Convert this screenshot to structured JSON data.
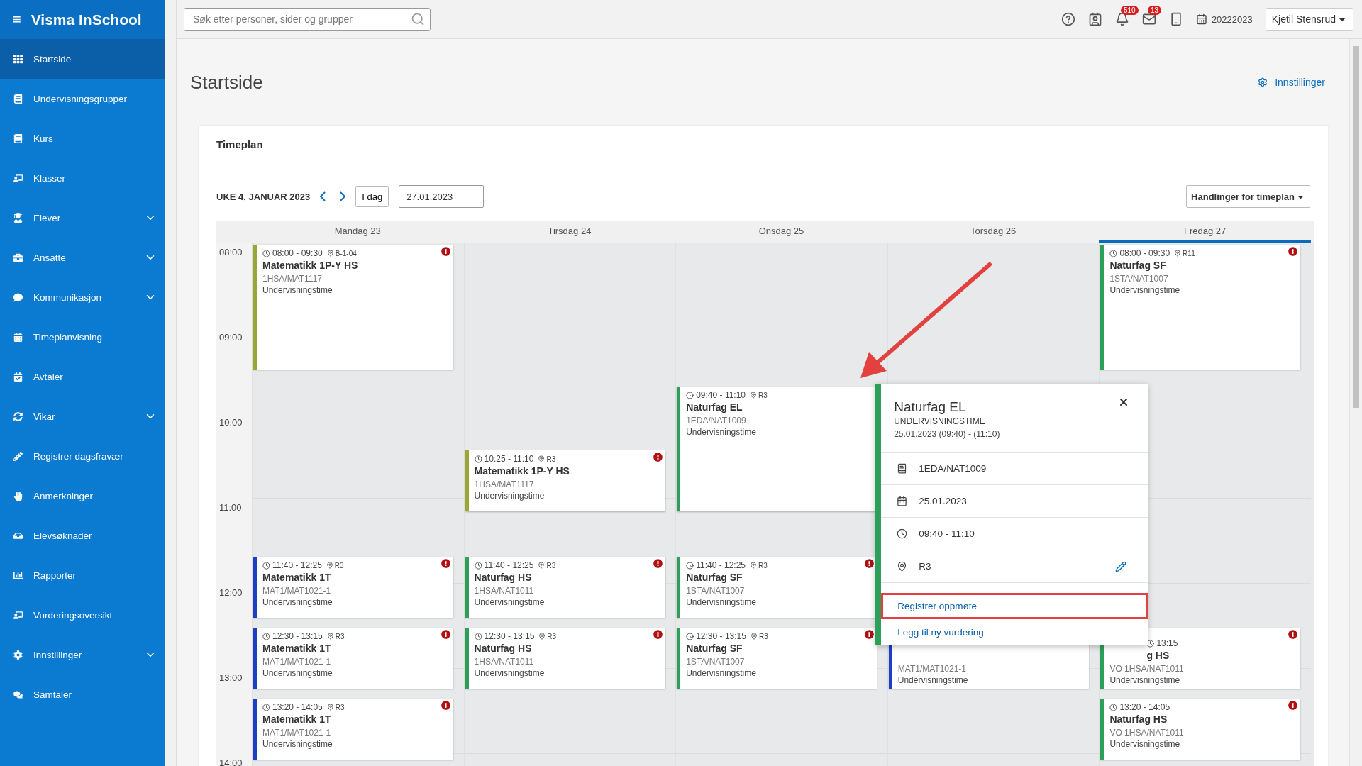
{
  "app": {
    "title": "Visma InSchool",
    "menu_icon": "≡"
  },
  "sidebar": {
    "items": [
      {
        "label": "Startside",
        "selected": true,
        "expandable": false
      },
      {
        "label": "Undervisningsgrupper",
        "selected": false,
        "expandable": false
      },
      {
        "label": "Kurs",
        "selected": false,
        "expandable": false
      },
      {
        "label": "Klasser",
        "selected": false,
        "expandable": false
      },
      {
        "label": "Elever",
        "selected": false,
        "expandable": true
      },
      {
        "label": "Ansatte",
        "selected": false,
        "expandable": true
      },
      {
        "label": "Kommunikasjon",
        "selected": false,
        "expandable": true
      },
      {
        "label": "Timeplanvisning",
        "selected": false,
        "expandable": false
      },
      {
        "label": "Avtaler",
        "selected": false,
        "expandable": false
      },
      {
        "label": "Vikar",
        "selected": false,
        "expandable": true
      },
      {
        "label": "Registrer dagsfravær",
        "selected": false,
        "expandable": false
      },
      {
        "label": "Anmerkninger",
        "selected": false,
        "expandable": false
      },
      {
        "label": "Elevsøknader",
        "selected": false,
        "expandable": false
      },
      {
        "label": "Rapporter",
        "selected": false,
        "expandable": false
      },
      {
        "label": "Vurderingsoversikt",
        "selected": false,
        "expandable": false
      },
      {
        "label": "Innstillinger",
        "selected": false,
        "expandable": true
      },
      {
        "label": "Samtaler",
        "selected": false,
        "expandable": false
      }
    ]
  },
  "topbar": {
    "search": {
      "placeholder": "Søk etter personer, sider og grupper"
    },
    "notifications": "510",
    "messages": "13",
    "school_year": "20222023",
    "user": "Kjetil Stensrud"
  },
  "page": {
    "title": "Startside",
    "settings_link": "Innstillinger"
  },
  "timeplan": {
    "title": "Timeplan",
    "week": "UKE 4, JANUAR 2023",
    "today_button": "I dag",
    "date": "27.01.2023",
    "actions_button": "Handlinger for timeplan",
    "hours": [
      "08:00",
      "09:00",
      "10:00",
      "11:00",
      "12:00",
      "13:00",
      "14:00"
    ],
    "days": [
      {
        "label": "Mandag 23",
        "selected": false,
        "events": [
          {
            "time": "08:00 - 09:30",
            "room": "B-1-04",
            "title": "Matematikk 1P-Y HS",
            "code": "1HSA/MAT1117",
            "type": "Undervisningstime",
            "color": "#9aa635",
            "alert": true
          },
          {
            "time": "11:40 - 12:25",
            "room": "R3",
            "title": "Matematikk 1T",
            "code": "MAT1/MAT1021-1",
            "type": "Undervisningstime",
            "color": "#1c3fc4",
            "alert": true
          },
          {
            "time": "12:30 - 13:15",
            "room": "R3",
            "title": "Matematikk 1T",
            "code": "MAT1/MAT1021-1",
            "type": "Undervisningstime",
            "color": "#1c3fc4",
            "alert": true
          },
          {
            "time": "13:20 - 14:05",
            "room": "R3",
            "title": "Matematikk 1T",
            "code": "MAT1/MAT1021-1",
            "type": "Undervisningstime",
            "color": "#1c3fc4",
            "alert": true
          }
        ]
      },
      {
        "label": "Tirsdag 24",
        "selected": false,
        "events": [
          {
            "time": "10:25 - 11:10",
            "room": "R3",
            "title": "Matematikk 1P-Y HS",
            "code": "1HSA/MAT1117",
            "type": "Undervisningstime",
            "color": "#9aa635",
            "alert": true
          },
          {
            "time": "11:40 - 12:25",
            "room": "R3",
            "title": "Naturfag HS",
            "code": "1HSA/NAT1011",
            "type": "Undervisningstime",
            "color": "#2e9e5b",
            "alert": true
          },
          {
            "time": "12:30 - 13:15",
            "room": "R3",
            "title": "Naturfag HS",
            "code": "1HSA/NAT1011",
            "type": "Undervisningstime",
            "color": "#2e9e5b",
            "alert": true
          }
        ]
      },
      {
        "label": "Onsdag 25",
        "selected": false,
        "events": [
          {
            "time": "09:40 - 11:10",
            "room": "R3",
            "title": "Naturfag EL",
            "code": "1EDA/NAT1009",
            "type": "Undervisningstime",
            "color": "#2e9e5b",
            "alert": false
          },
          {
            "time": "11:40 - 12:25",
            "room": "R3",
            "title": "Naturfag SF",
            "code": "1STA/NAT1007",
            "type": "Undervisningstime",
            "color": "#2e9e5b",
            "alert": true
          },
          {
            "time": "12:30 - 13:15",
            "room": "R3",
            "title": "Naturfag SF",
            "code": "1STA/NAT1007",
            "type": "Undervisningstime",
            "color": "#2e9e5b",
            "alert": true
          }
        ]
      },
      {
        "label": "Torsdag 26",
        "selected": false,
        "events": [
          {
            "code": "MAT1/MAT1021-1",
            "type": "Undervisningstime",
            "color": "#1c3fc4",
            "alert": false,
            "covered": true
          }
        ]
      },
      {
        "label": "Fredag 27",
        "selected": true,
        "events": [
          {
            "time": "08:00 - 09:30",
            "room": "R11",
            "title": "Naturfag SF",
            "code": "1STA/NAT1007",
            "type": "Undervisningstime",
            "color": "#2e9e5b",
            "alert": true
          },
          {
            "time": "13:15",
            "title": "g HS",
            "code": "VO 1HSA/NAT1011",
            "type": "Undervisningstime",
            "color": "#2e9e5b",
            "alert": true,
            "covered": true
          },
          {
            "time": "13:20 - 14:05",
            "title": "Naturfag HS",
            "code": "VO 1HSA/NAT1011",
            "type": "Undervisningstime",
            "color": "#2e9e5b",
            "alert": true
          }
        ]
      }
    ]
  },
  "popup": {
    "title": "Naturfag EL",
    "subtitle": "UNDERVISNINGSTIME",
    "datetime": "25.01.2023 (09:40) - (11:10)",
    "rows": [
      {
        "kind": "group",
        "text": "1EDA/NAT1009",
        "editable": false
      },
      {
        "kind": "date",
        "text": "25.01.2023",
        "editable": false
      },
      {
        "kind": "time",
        "text": "09:40 - 11:10",
        "editable": false
      },
      {
        "kind": "room",
        "text": "R3",
        "editable": true
      }
    ],
    "actions": [
      {
        "label": "Registrer oppmøte",
        "highlighted": true
      },
      {
        "label": "Legg til ny vurdering",
        "highlighted": false
      }
    ]
  }
}
